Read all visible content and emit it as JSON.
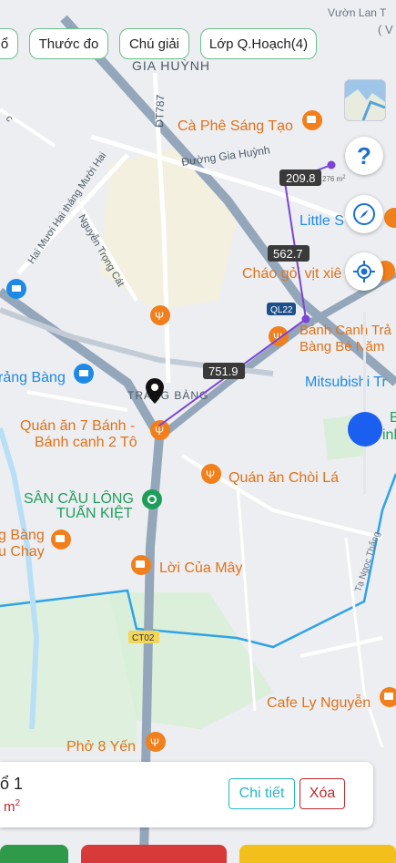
{
  "toolbar": {
    "chips": [
      {
        "label": "ổ"
      },
      {
        "label": "Thước đo"
      },
      {
        "label": "Chú giải"
      },
      {
        "label": "Lớp Q.Hoạch(4)"
      }
    ]
  },
  "map": {
    "top_left_text": "Vườn Lan T",
    "top_right_text": "( V",
    "district": "GIA HUỲNH",
    "district_prefix": "H",
    "road_dt787": "ĐT787",
    "road_gia_huynh": "Đường Gia Huỳnh",
    "road_hmht": "Hai Mươi Hai tháng Mười Hai",
    "road_ntc": "Nguyễn Trọng Cát",
    "road_c": "c",
    "road_ql22": "QL22",
    "road_ct02": "CT02",
    "road_yen_thang": "Tạ Ngọc Thắng",
    "area_trang_bang": "TRẢNG BÀNG",
    "poi_cafe_sang_tao": "Cà Phê Sáng Tạo",
    "poi_little": "Little S",
    "poi_chao_vit": "Cháo gỏi vịt xiê",
    "poi_banh_canh_1": "Bánh Canh Trả",
    "poi_banh_canh_2": "Bàng Bé Năm",
    "poi_mitsubishi": "Mitsubishi Tr",
    "poi_trang_bang_shop": "rảng Bàng",
    "poi_quan_an_7_1": "Quán ăn 7 Bánh -",
    "poi_quan_an_7_2": "Bánh canh 2 Tô",
    "poi_choi_la": "Quán ăn Chòi Lá",
    "poi_san_cau_1": "SÂN CẦU LÔNG",
    "poi_san_cau_2": "TUẤN KIỆT",
    "poi_bang_chay_1": "g Bàng",
    "poi_bang_chay_2": "u Chay",
    "poi_loi_cua_may": "Lời Của Mây",
    "poi_cafe_ly": "Cafe Ly Nguyễn",
    "poi_pho8": "Phở 8 Yến",
    "poi_b_1": "B",
    "poi_b_2": "inh"
  },
  "measurements": {
    "segment_1": "209.8",
    "segment_2": "562.7",
    "segment_3": "751.9",
    "area_label": "276 m",
    "area_sup": "2",
    "line_color": "#7a44d6"
  },
  "controls": {
    "help_icon": "question-icon",
    "compass_icon": "compass-icon",
    "locate_icon": "locate-icon",
    "help_symbol": "?",
    "zoom_level": 0.5
  },
  "card": {
    "title": "ổ 1",
    "subtitle": "m",
    "subtitle_sup": "2",
    "detail_label": "Chi tiết",
    "delete_label": "Xóa"
  },
  "bottom_bar": {
    "colors": [
      "#2f9a4a",
      "#d83a3a",
      "#f3bf1a"
    ]
  },
  "colors": {
    "accent_green": "#6dbf8c",
    "poi_orange": "#f07f1c",
    "shop_blue": "#1e8ae6",
    "river": "#2ea3e6",
    "road": "#94a6ba"
  }
}
